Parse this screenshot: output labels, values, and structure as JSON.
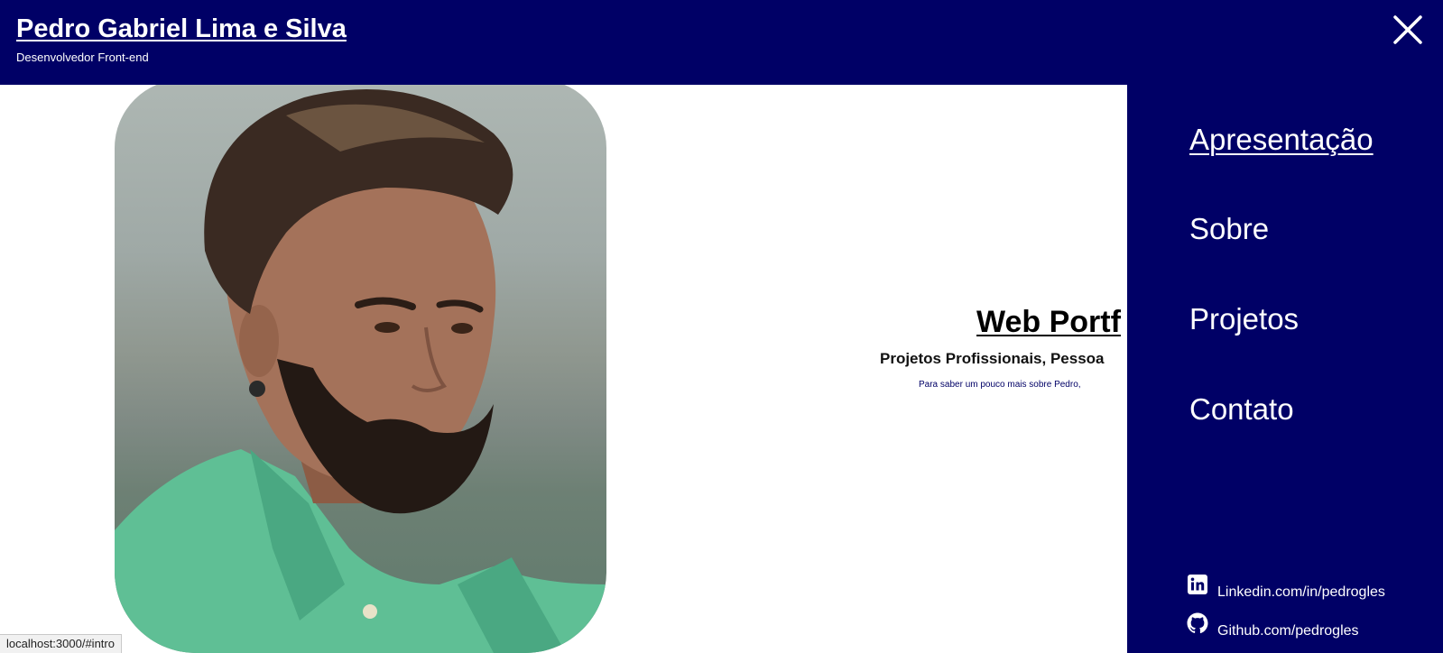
{
  "header": {
    "name": "Pedro Gabriel Lima e Silva",
    "role": "Desenvolvedor Front-end",
    "close_icon": "close-icon"
  },
  "intro": {
    "title": "Web Portf",
    "subtitle": "Projetos Profissionais, Pessoa",
    "small_text": "Para saber um pouco mais sobre Pedro,"
  },
  "nav": {
    "items": [
      {
        "label": "Apresentação",
        "active": true
      },
      {
        "label": "Sobre",
        "active": false
      },
      {
        "label": "Projetos",
        "active": false
      },
      {
        "label": "Contato",
        "active": false
      }
    ]
  },
  "social": {
    "linkedin": {
      "icon": "linkedin-icon",
      "label": "Linkedin.com/in/pedrogles"
    },
    "github": {
      "icon": "github-icon",
      "label": "Github.com/pedrogles"
    }
  },
  "status": {
    "url": "localhost:3000/#intro"
  },
  "colors": {
    "primary": "#000066",
    "background": "#ffffff",
    "text_on_primary": "#ffffff"
  }
}
